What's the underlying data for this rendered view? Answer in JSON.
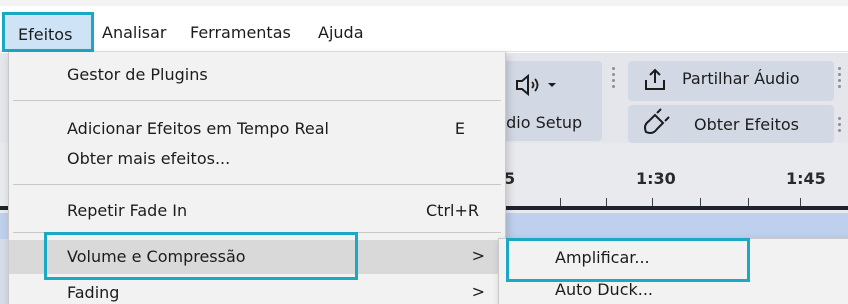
{
  "menubar": {
    "items": [
      {
        "label": "Efeitos"
      },
      {
        "label": "Analisar"
      },
      {
        "label": "Ferramentas"
      },
      {
        "label": "Ajuda"
      }
    ]
  },
  "toolbar": {
    "audio_setup_label": "udio Setup",
    "share_audio_label": "Partilhar Áudio",
    "get_effects_label": "Obter Efeitos"
  },
  "timeline": {
    "ticks": [
      "5",
      "1:30",
      "1:45"
    ]
  },
  "effects_menu": {
    "items": [
      {
        "label": "Gestor de Plugins",
        "shortcut": ""
      },
      {
        "label": "Adicionar Efeitos em Tempo Real",
        "shortcut": "E"
      },
      {
        "label": "Obter mais efeitos...",
        "shortcut": ""
      },
      {
        "label": "Repetir Fade In",
        "shortcut": "Ctrl+R"
      },
      {
        "label": "Volume e Compressão",
        "shortcut": "",
        "submenu_arrow": ">"
      },
      {
        "label": "Fading",
        "shortcut": "",
        "submenu_arrow": ">"
      }
    ]
  },
  "volume_submenu": {
    "items": [
      {
        "label": "Amplificar..."
      },
      {
        "label": "Auto Duck..."
      }
    ]
  },
  "colors": {
    "highlight_border": "#1aa8c4",
    "active_menu_bg": "#cfe3f7",
    "menu_bg": "#f2f2f2",
    "hover_bg": "#d9d9d9"
  }
}
